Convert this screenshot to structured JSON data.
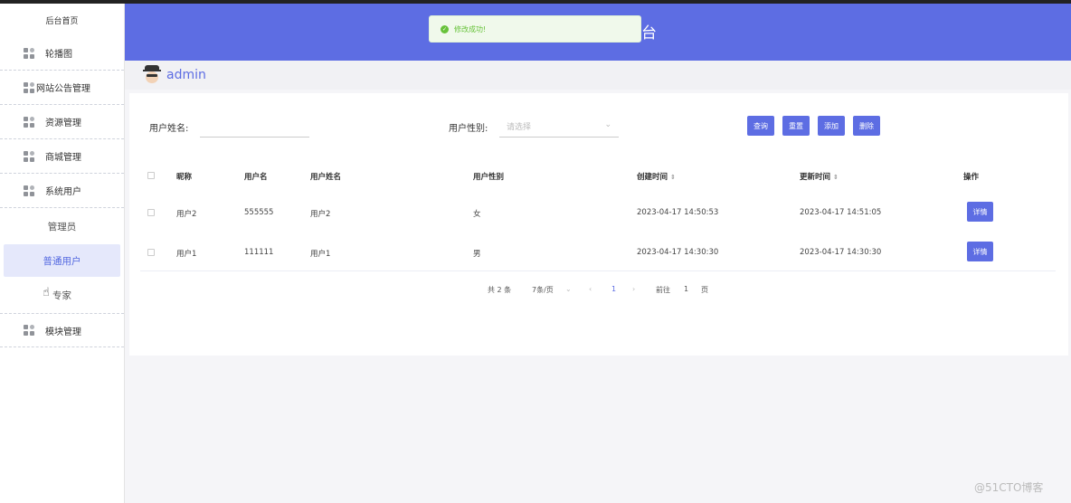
{
  "sidebar": {
    "home": "后台首页",
    "menus": [
      {
        "label": "轮播图"
      },
      {
        "label": "网站公告管理"
      },
      {
        "label": "资源管理"
      },
      {
        "label": "商城管理"
      },
      {
        "label": "系统用户"
      }
    ],
    "sub": [
      "管理员",
      "普通用户",
      "专家"
    ],
    "last_menu": "模块管理"
  },
  "header": {
    "title_fragment": "台"
  },
  "toast": {
    "message": "修改成功!",
    "icon": "check-circle-icon"
  },
  "user": {
    "name": "admin"
  },
  "filters": {
    "name_label": "用户姓名:",
    "gender_label": "用户性别:",
    "gender_placeholder": "请选择"
  },
  "buttons": {
    "query": "查询",
    "reset": "重置",
    "add": "添加",
    "delete": "删除"
  },
  "table": {
    "headers": {
      "nickname": "昵称",
      "username": "用户名",
      "realname": "用户姓名",
      "gender": "用户性别",
      "created": "创建时间",
      "updated": "更新时间",
      "action": "操作"
    },
    "rows": [
      {
        "nickname": "用户2",
        "username": "555555",
        "realname": "用户2",
        "gender": "女",
        "created": "2023-04-17 14:50:53",
        "updated": "2023-04-17 14:51:05",
        "action": "详情"
      },
      {
        "nickname": "用户1",
        "username": "111111",
        "realname": "用户1",
        "gender": "男",
        "created": "2023-04-17 14:30:30",
        "updated": "2023-04-17 14:30:30",
        "action": "详情"
      }
    ]
  },
  "pagination": {
    "total": "共 2 条",
    "page_size": "7条/页",
    "current_page": "1",
    "goto_label": "前往",
    "goto_value": "1",
    "page_unit": "页"
  },
  "watermark": "@51CTO博客",
  "colors": {
    "accent": "#5d6de3",
    "success": "#67c23a"
  }
}
